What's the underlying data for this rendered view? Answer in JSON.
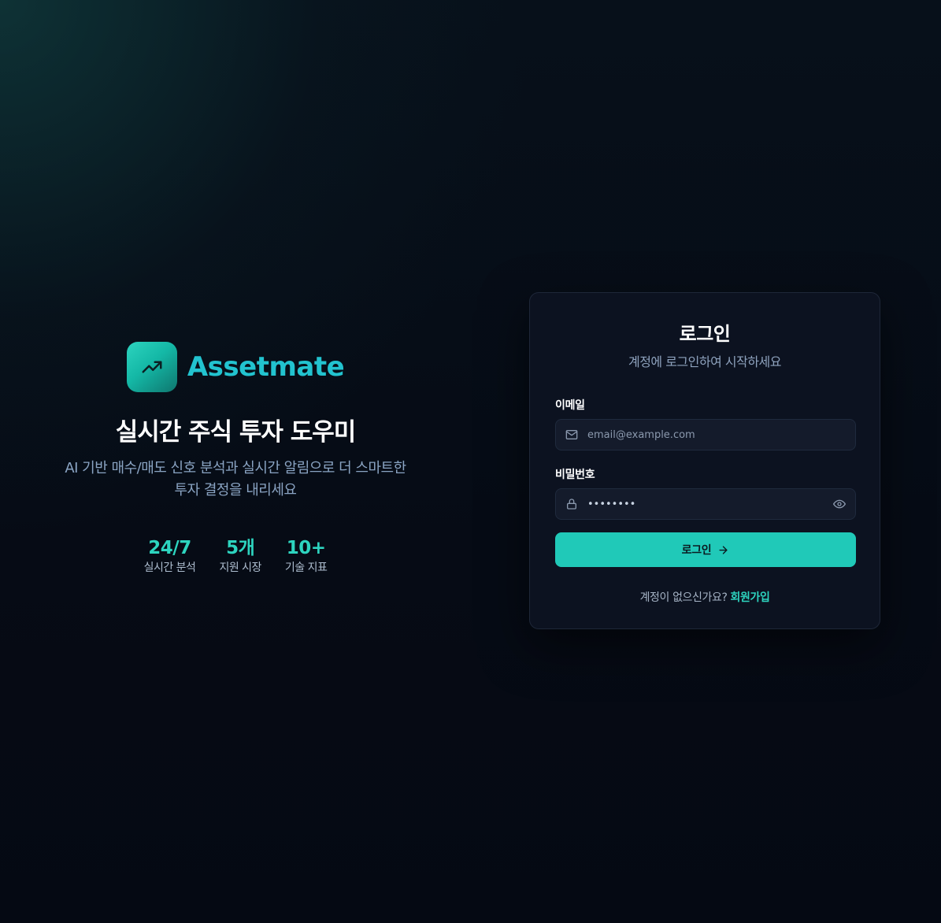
{
  "hero": {
    "brand_name": "Assetmate",
    "logo_icon": "trending-up-icon",
    "title": "실시간 주식 투자 도우미",
    "subtitle_line1": "AI 기반 매수/매도 신호 분석과 실시간 알림으로 더 스마트한",
    "subtitle_line2": "투자 결정을 내리세요",
    "stats": [
      {
        "value": "24/7",
        "label": "실시간 분석"
      },
      {
        "value": "5개",
        "label": "지원 시장"
      },
      {
        "value": "10+",
        "label": "기술 지표"
      }
    ]
  },
  "login": {
    "title": "로그인",
    "subtitle": "계정에 로그인하여 시작하세요",
    "email": {
      "label": "이메일",
      "placeholder": "email@example.com",
      "value": "",
      "icon": "mail-icon"
    },
    "password": {
      "label": "비밀번호",
      "value": "••••••••",
      "icon": "lock-icon",
      "toggle_icon": "eye-icon"
    },
    "submit_label": "로그인",
    "submit_icon": "arrow-right-icon",
    "signup_prompt": "계정이 없으신가요?",
    "signup_link": "회원가입"
  },
  "colors": {
    "accent": "#20c9b8",
    "brand_text": "#22c3cf",
    "background": "#060b15",
    "card": "#0c1220"
  }
}
